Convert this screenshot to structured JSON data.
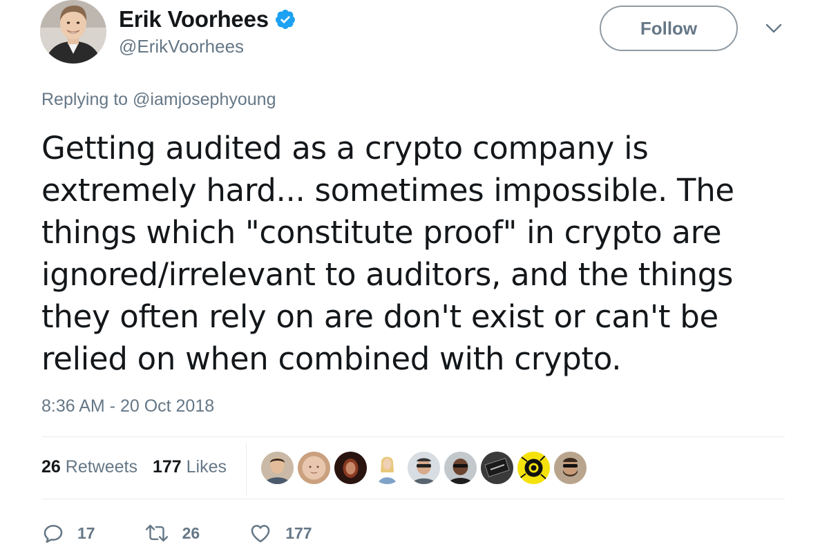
{
  "user": {
    "display_name": "Erik Voorhees",
    "handle": "@ErikVoorhees",
    "verified": true,
    "avatar_icon": "user-avatar"
  },
  "follow_button": {
    "label": "Follow"
  },
  "menu": {
    "icon": "chevron-down-icon"
  },
  "reply_context": {
    "prefix": "Replying to",
    "mention": "@iamjosephyoung"
  },
  "tweet": {
    "text": "Getting audited as a crypto company is extremely hard... sometimes impossible. The things which \"constitute proof\" in crypto are ignored/irrelevant to auditors, and the things they often rely on are don't exist or can't be relied on when combined with crypto.",
    "timestamp": "8:36 AM - 20 Oct 2018"
  },
  "stats": {
    "retweets_count": "26",
    "retweets_label": "Retweets",
    "likes_count": "177",
    "likes_label": "Likes"
  },
  "likers": [
    {
      "icon": "liker-avatar-1"
    },
    {
      "icon": "liker-avatar-2"
    },
    {
      "icon": "liker-avatar-3"
    },
    {
      "icon": "liker-avatar-4"
    },
    {
      "icon": "liker-avatar-5"
    },
    {
      "icon": "liker-avatar-6"
    },
    {
      "icon": "liker-avatar-7"
    },
    {
      "icon": "liker-avatar-8"
    },
    {
      "icon": "liker-avatar-9"
    }
  ],
  "actions": {
    "reply_count": "17",
    "retweet_count": "26",
    "like_count": "177"
  },
  "colors": {
    "text_primary": "#14171a",
    "text_secondary": "#657786",
    "verified_blue": "#1da1f2",
    "divider": "#e6ecf0"
  }
}
